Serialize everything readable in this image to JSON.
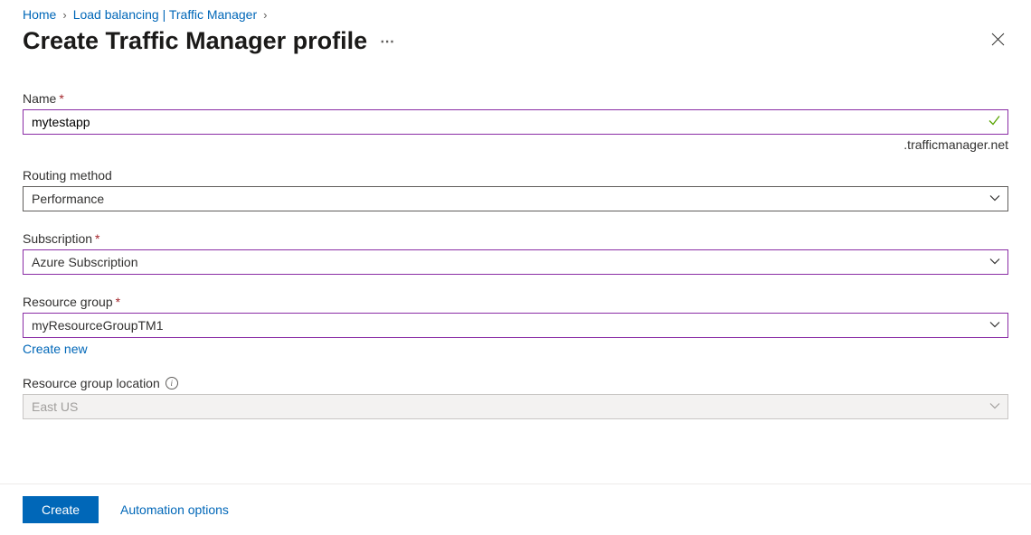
{
  "breadcrumb": {
    "home": "Home",
    "loadbalancing": "Load balancing | Traffic Manager"
  },
  "header": {
    "title": "Create Traffic Manager profile"
  },
  "form": {
    "name": {
      "label": "Name",
      "value": "mytestapp",
      "suffix": ".trafficmanager.net"
    },
    "routing": {
      "label": "Routing method",
      "value": "Performance"
    },
    "subscription": {
      "label": "Subscription",
      "value": "Azure Subscription"
    },
    "resourcegroup": {
      "label": "Resource group",
      "value": "myResourceGroupTM1",
      "createnew": "Create new"
    },
    "rglocation": {
      "label": "Resource group location",
      "value": "East US"
    }
  },
  "footer": {
    "create": "Create",
    "automation": "Automation options"
  }
}
